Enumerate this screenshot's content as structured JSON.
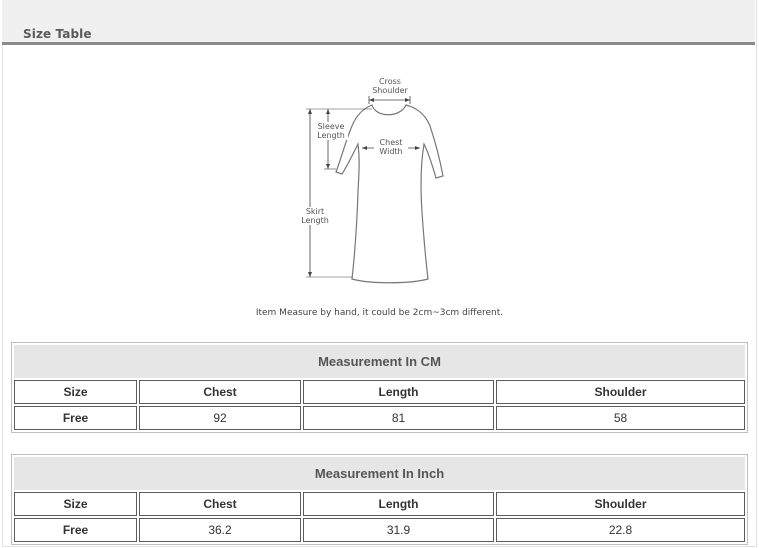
{
  "header": {
    "title": "Size Table"
  },
  "diagram": {
    "labels": {
      "cross_shoulder_1": "Cross",
      "cross_shoulder_2": "Shoulder",
      "sleeve_length_1": "Sleeve",
      "sleeve_length_2": "Length",
      "chest_width_1": "Chest",
      "chest_width_2": "Width",
      "skirt_length_1": "Skirt",
      "skirt_length_2": "Length"
    },
    "note": "Item Measure by hand, it could be 2cm~3cm different."
  },
  "tables": {
    "cm": {
      "caption": "Measurement In CM",
      "headers": [
        "Size",
        "Chest",
        "Length",
        "Shoulder"
      ],
      "row": [
        "Free",
        "92",
        "81",
        "58"
      ]
    },
    "inch": {
      "caption": "Measurement In Inch",
      "headers": [
        "Size",
        "Chest",
        "Length",
        "Shoulder"
      ],
      "row": [
        "Free",
        "36.2",
        "31.9",
        "22.8"
      ]
    }
  }
}
